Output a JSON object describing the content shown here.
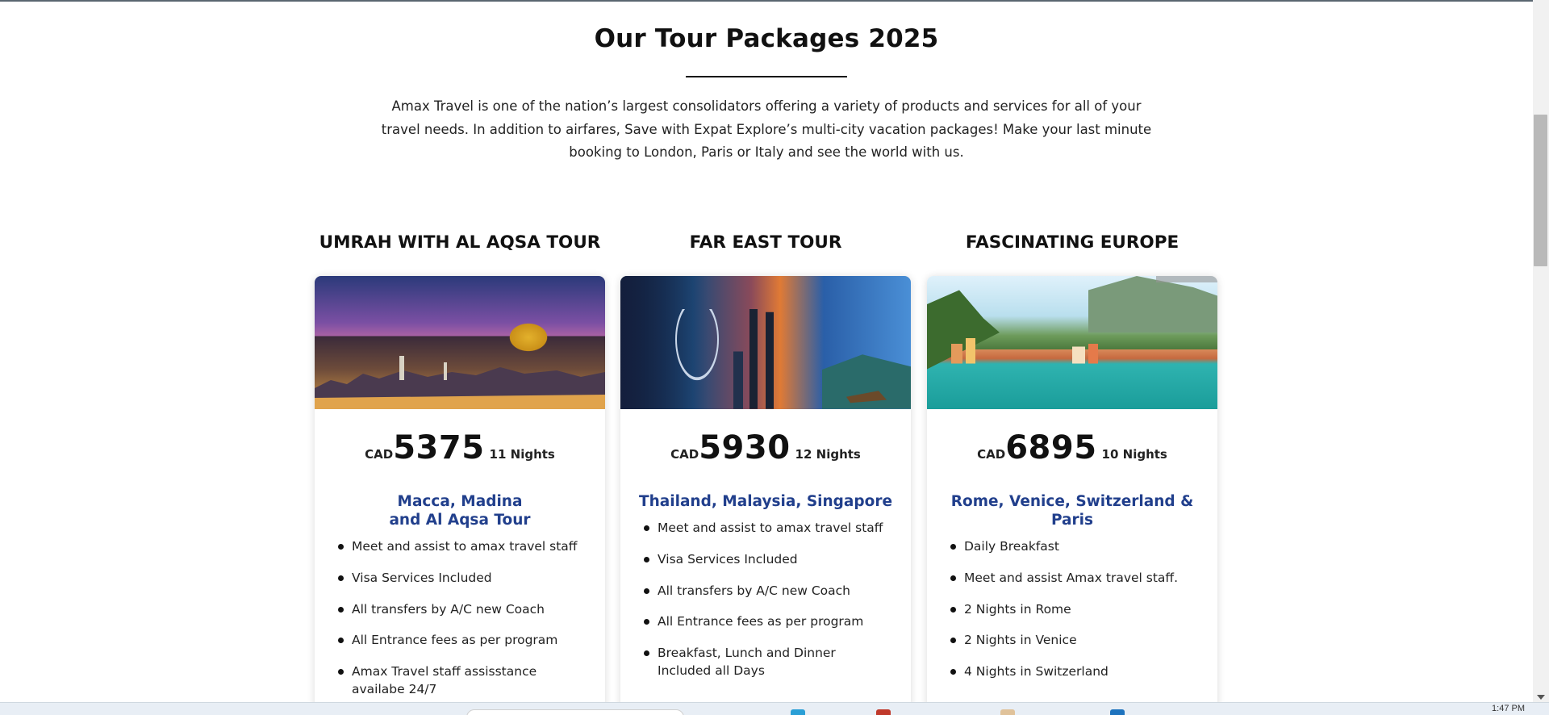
{
  "page": {
    "heading": "Our Tour Packages 2025",
    "intro": "Amax Travel is one of the nation’s largest consolidators offering a variety of products and services for all of your travel needs. In addition to airfares, Save with Expat Explore’s multi-city vacation packages! Make your last minute booking to London, Paris or Italy and see the world with us."
  },
  "colors": {
    "heading": "#111111",
    "destination": "#213f8c",
    "text": "#222222"
  },
  "packages": [
    {
      "title": "UMRAH WITH AL AQSA TOUR",
      "image": "jerusalem-dome-of-the-rock-photo",
      "currency": "CAD",
      "price": "5375",
      "nights": "11 Nights",
      "destination_line1": "Macca, Madina",
      "destination_line2": "and Al Aqsa Tour",
      "features": [
        "Meet and assist to amax travel staff",
        "Visa Services Included",
        "All transfers by A/C new Coach",
        "All Entrance fees as per program",
        "Amax Travel staff assisstance availabe 24/7"
      ]
    },
    {
      "title": "FAR EAST TOUR",
      "image": "singapore-kuala-lumpur-thailand-collage-photo",
      "currency": "CAD",
      "price": "5930",
      "nights": "12 Nights",
      "destination_line1": "Thailand, Malaysia, Singapore",
      "destination_line2": "",
      "features": [
        "Meet and assist to amax travel staff",
        "Visa Services Included",
        "All transfers by A/C new Coach",
        "All Entrance fees as per program",
        "Breakfast, Lunch and Dinner Included all Days"
      ]
    },
    {
      "title": "FASCINATING EUROPE",
      "image": "italian-lake-village-photo",
      "currency": "CAD",
      "price": "6895",
      "nights": "10 Nights",
      "destination_line1": "Rome, Venice, Switzerland &",
      "destination_line2": "Paris",
      "features": [
        "Daily Breakfast",
        "Meet and assist Amax travel staff.",
        "2 Nights in Rome",
        "2 Nights in Venice",
        "4 Nights in Switzerland"
      ]
    }
  ],
  "taskbar": {
    "clock": "1:47 PM"
  }
}
